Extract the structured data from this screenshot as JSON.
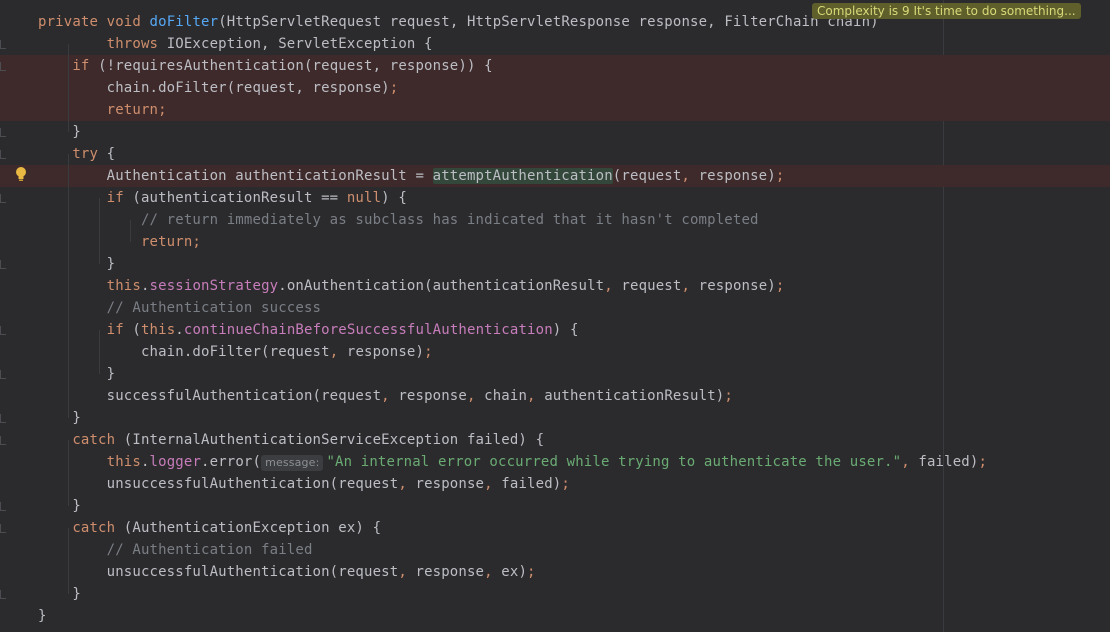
{
  "editor": {
    "lines": [
      {
        "err": false,
        "segs": [
          {
            "t": "private ",
            "c": "kw"
          },
          {
            "t": "void ",
            "c": "kw"
          },
          {
            "t": "doFilter",
            "c": "fn"
          },
          {
            "t": "(HttpServletRequest request, HttpServletResponse response, FilterChain chain)",
            "c": "ident"
          }
        ]
      },
      {
        "err": false,
        "segs": [
          {
            "t": "        throws ",
            "c": "kw"
          },
          {
            "t": "IOException, ServletException {",
            "c": "ident"
          }
        ]
      },
      {
        "err": true,
        "segs": [
          {
            "t": "    if ",
            "c": "kw"
          },
          {
            "t": "(!requiresAuthentication(request, response)) {",
            "c": "ident"
          }
        ]
      },
      {
        "err": true,
        "segs": [
          {
            "t": "        chain.doFilter(request, response)",
            "c": "ident"
          },
          {
            "t": ";",
            "c": "kw"
          }
        ]
      },
      {
        "err": true,
        "segs": [
          {
            "t": "        return;",
            "c": "kw"
          }
        ]
      },
      {
        "err": false,
        "segs": [
          {
            "t": "    }",
            "c": "ident"
          }
        ]
      },
      {
        "err": false,
        "segs": [
          {
            "t": "    try ",
            "c": "kw"
          },
          {
            "t": "{",
            "c": "ident"
          }
        ]
      },
      {
        "err": true,
        "segs": [
          {
            "t": "        Authentication authenticationResult = ",
            "c": "ident"
          },
          {
            "t": "attemptAuthentication",
            "c": "hl"
          },
          {
            "t": "(request",
            "c": "ident"
          },
          {
            "t": ", ",
            "c": "kw"
          },
          {
            "t": "response)",
            "c": "ident"
          },
          {
            "t": ";",
            "c": "kw"
          }
        ]
      },
      {
        "err": false,
        "segs": [
          {
            "t": "        if ",
            "c": "kw"
          },
          {
            "t": "(authenticationResult == ",
            "c": "ident"
          },
          {
            "t": "null",
            "c": "kw"
          },
          {
            "t": ") {",
            "c": "ident"
          }
        ]
      },
      {
        "err": false,
        "segs": [
          {
            "t": "            // return immediately as subclass has indicated that it hasn't completed",
            "c": "cmt"
          }
        ]
      },
      {
        "err": false,
        "segs": [
          {
            "t": "            return;",
            "c": "kw"
          }
        ]
      },
      {
        "err": false,
        "segs": [
          {
            "t": "        }",
            "c": "ident"
          }
        ]
      },
      {
        "err": false,
        "segs": [
          {
            "t": "        this",
            "c": "kw"
          },
          {
            "t": ".",
            "c": "ident"
          },
          {
            "t": "sessionStrategy",
            "c": "field"
          },
          {
            "t": ".onAuthentication(authenticationResult",
            "c": "ident"
          },
          {
            "t": ", ",
            "c": "kw"
          },
          {
            "t": "request",
            "c": "ident"
          },
          {
            "t": ", ",
            "c": "kw"
          },
          {
            "t": "response)",
            "c": "ident"
          },
          {
            "t": ";",
            "c": "kw"
          }
        ]
      },
      {
        "err": false,
        "segs": [
          {
            "t": "        // Authentication success",
            "c": "cmt"
          }
        ]
      },
      {
        "err": false,
        "segs": [
          {
            "t": "        if ",
            "c": "kw"
          },
          {
            "t": "(",
            "c": "ident"
          },
          {
            "t": "this",
            "c": "kw"
          },
          {
            "t": ".",
            "c": "ident"
          },
          {
            "t": "continueChainBeforeSuccessfulAuthentication",
            "c": "field"
          },
          {
            "t": ") {",
            "c": "ident"
          }
        ]
      },
      {
        "err": false,
        "segs": [
          {
            "t": "            chain.doFilter(request",
            "c": "ident"
          },
          {
            "t": ", ",
            "c": "kw"
          },
          {
            "t": "response)",
            "c": "ident"
          },
          {
            "t": ";",
            "c": "kw"
          }
        ]
      },
      {
        "err": false,
        "segs": [
          {
            "t": "        }",
            "c": "ident"
          }
        ]
      },
      {
        "err": false,
        "segs": [
          {
            "t": "        successfulAuthentication(request",
            "c": "ident"
          },
          {
            "t": ", ",
            "c": "kw"
          },
          {
            "t": "response",
            "c": "ident"
          },
          {
            "t": ", ",
            "c": "kw"
          },
          {
            "t": "chain",
            "c": "ident"
          },
          {
            "t": ", ",
            "c": "kw"
          },
          {
            "t": "authenticationResult)",
            "c": "ident"
          },
          {
            "t": ";",
            "c": "kw"
          }
        ]
      },
      {
        "err": false,
        "segs": [
          {
            "t": "    }",
            "c": "ident"
          }
        ]
      },
      {
        "err": false,
        "segs": [
          {
            "t": "    catch ",
            "c": "kw"
          },
          {
            "t": "(InternalAuthenticationServiceException failed) {",
            "c": "ident"
          }
        ]
      },
      {
        "err": false,
        "segs": [
          {
            "t": "        this",
            "c": "kw"
          },
          {
            "t": ".",
            "c": "ident"
          },
          {
            "t": "logger",
            "c": "field"
          },
          {
            "t": ".error(",
            "c": "ident"
          },
          {
            "t": "message:",
            "c": "hint"
          },
          {
            "t": "\"An internal error occurred while trying to authenticate the user.\"",
            "c": "str"
          },
          {
            "t": ", ",
            "c": "kw"
          },
          {
            "t": "failed)",
            "c": "ident"
          },
          {
            "t": ";",
            "c": "kw"
          }
        ]
      },
      {
        "err": false,
        "segs": [
          {
            "t": "        unsuccessfulAuthentication(request",
            "c": "ident"
          },
          {
            "t": ", ",
            "c": "kw"
          },
          {
            "t": "response",
            "c": "ident"
          },
          {
            "t": ", ",
            "c": "kw"
          },
          {
            "t": "failed)",
            "c": "ident"
          },
          {
            "t": ";",
            "c": "kw"
          }
        ]
      },
      {
        "err": false,
        "segs": [
          {
            "t": "    }",
            "c": "ident"
          }
        ]
      },
      {
        "err": false,
        "segs": [
          {
            "t": "    catch ",
            "c": "kw"
          },
          {
            "t": "(AuthenticationException ex) {",
            "c": "ident"
          }
        ]
      },
      {
        "err": false,
        "segs": [
          {
            "t": "        // Authentication failed",
            "c": "cmt"
          }
        ]
      },
      {
        "err": false,
        "segs": [
          {
            "t": "        unsuccessfulAuthentication(request",
            "c": "ident"
          },
          {
            "t": ", ",
            "c": "kw"
          },
          {
            "t": "response",
            "c": "ident"
          },
          {
            "t": ", ",
            "c": "kw"
          },
          {
            "t": "ex)",
            "c": "ident"
          },
          {
            "t": ";",
            "c": "kw"
          }
        ]
      },
      {
        "err": false,
        "segs": [
          {
            "t": "    }",
            "c": "ident"
          }
        ]
      },
      {
        "err": false,
        "segs": [
          {
            "t": "}",
            "c": "ident"
          }
        ]
      }
    ],
    "complexity_badge": "Complexity is 9 It's time to do something...",
    "gutter_icon": "lightbulb-icon"
  },
  "colors": {
    "background": "#2b2b2d",
    "error_line": "#3e2a2b",
    "keyword": "#cf8e6d",
    "method": "#56a8f5",
    "string": "#6aab73",
    "comment": "#7a7e85",
    "field": "#c77dbb",
    "badge": "#5e5f2a",
    "bulb": "#e8b842"
  }
}
